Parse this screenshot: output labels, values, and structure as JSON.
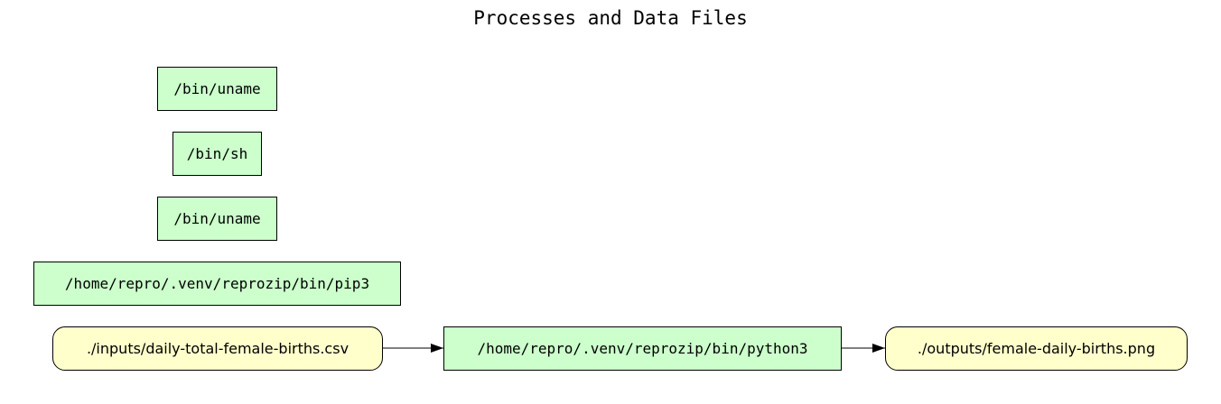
{
  "title": "Processes and Data Files",
  "processes": [
    "/bin/uname",
    "/bin/sh",
    "/bin/uname",
    "/home/repro/.venv/reprozip/bin/pip3",
    "/home/repro/.venv/reprozip/bin/python3"
  ],
  "files": {
    "input": "./inputs/daily-total-female-births.csv",
    "output": "./outputs/female-daily-births.png"
  },
  "colors": {
    "process_fill": "#ccffcc",
    "file_fill": "#ffffcc",
    "stroke": "#000000"
  }
}
